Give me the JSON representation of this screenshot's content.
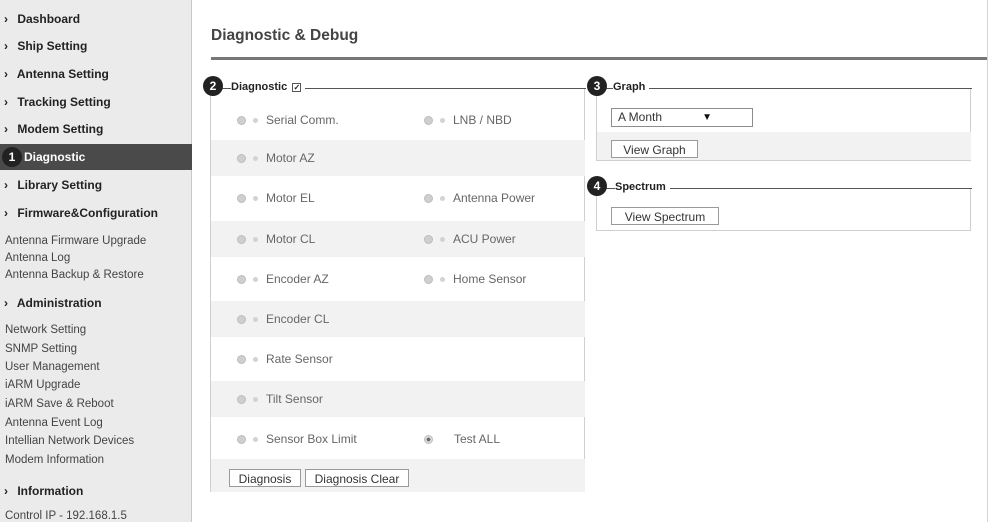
{
  "sidebar": {
    "nav": [
      {
        "label": "Dashboard"
      },
      {
        "label": "Ship Setting"
      },
      {
        "label": "Antenna Setting"
      },
      {
        "label": "Tracking Setting"
      },
      {
        "label": "Modem Setting"
      },
      {
        "label": "Diagnostic"
      },
      {
        "label": "Library Setting"
      },
      {
        "label": "Firmware&Configuration"
      },
      {
        "label": "Administration"
      },
      {
        "label": "Information"
      }
    ],
    "firmware_sub": [
      "Antenna Firmware Upgrade",
      "Antenna Log",
      "Antenna Backup & Restore"
    ],
    "admin_sub": [
      "Network Setting",
      "SNMP Setting",
      "User Management",
      "iARM Upgrade",
      "iARM Save & Reboot",
      "Antenna Event Log",
      "Intellian Network Devices",
      "Modem Information"
    ],
    "info_sub": [
      "Control IP - 192.168.1.5"
    ]
  },
  "callouts": [
    "1",
    "2",
    "3",
    "4"
  ],
  "main": {
    "title": "Diagnostic & Debug",
    "diagnostic": {
      "legend": "Diagnostic",
      "items_left": [
        "Serial Comm.",
        "Motor AZ",
        "Motor EL",
        "Motor CL",
        "Encoder AZ",
        "Encoder CL",
        "Rate Sensor",
        "Tilt Sensor",
        "Sensor Box Limit"
      ],
      "items_right": [
        "LNB / NBD",
        "Antenna Power",
        "ACU Power",
        "Home Sensor",
        "Test ALL"
      ],
      "diagnosis_button": "Diagnosis",
      "clear_button": "Diagnosis Clear"
    },
    "graph": {
      "legend": "Graph",
      "period_selected": "A Month",
      "view_button": "View Graph"
    },
    "spectrum": {
      "legend": "Spectrum",
      "view_button": "View Spectrum"
    }
  }
}
